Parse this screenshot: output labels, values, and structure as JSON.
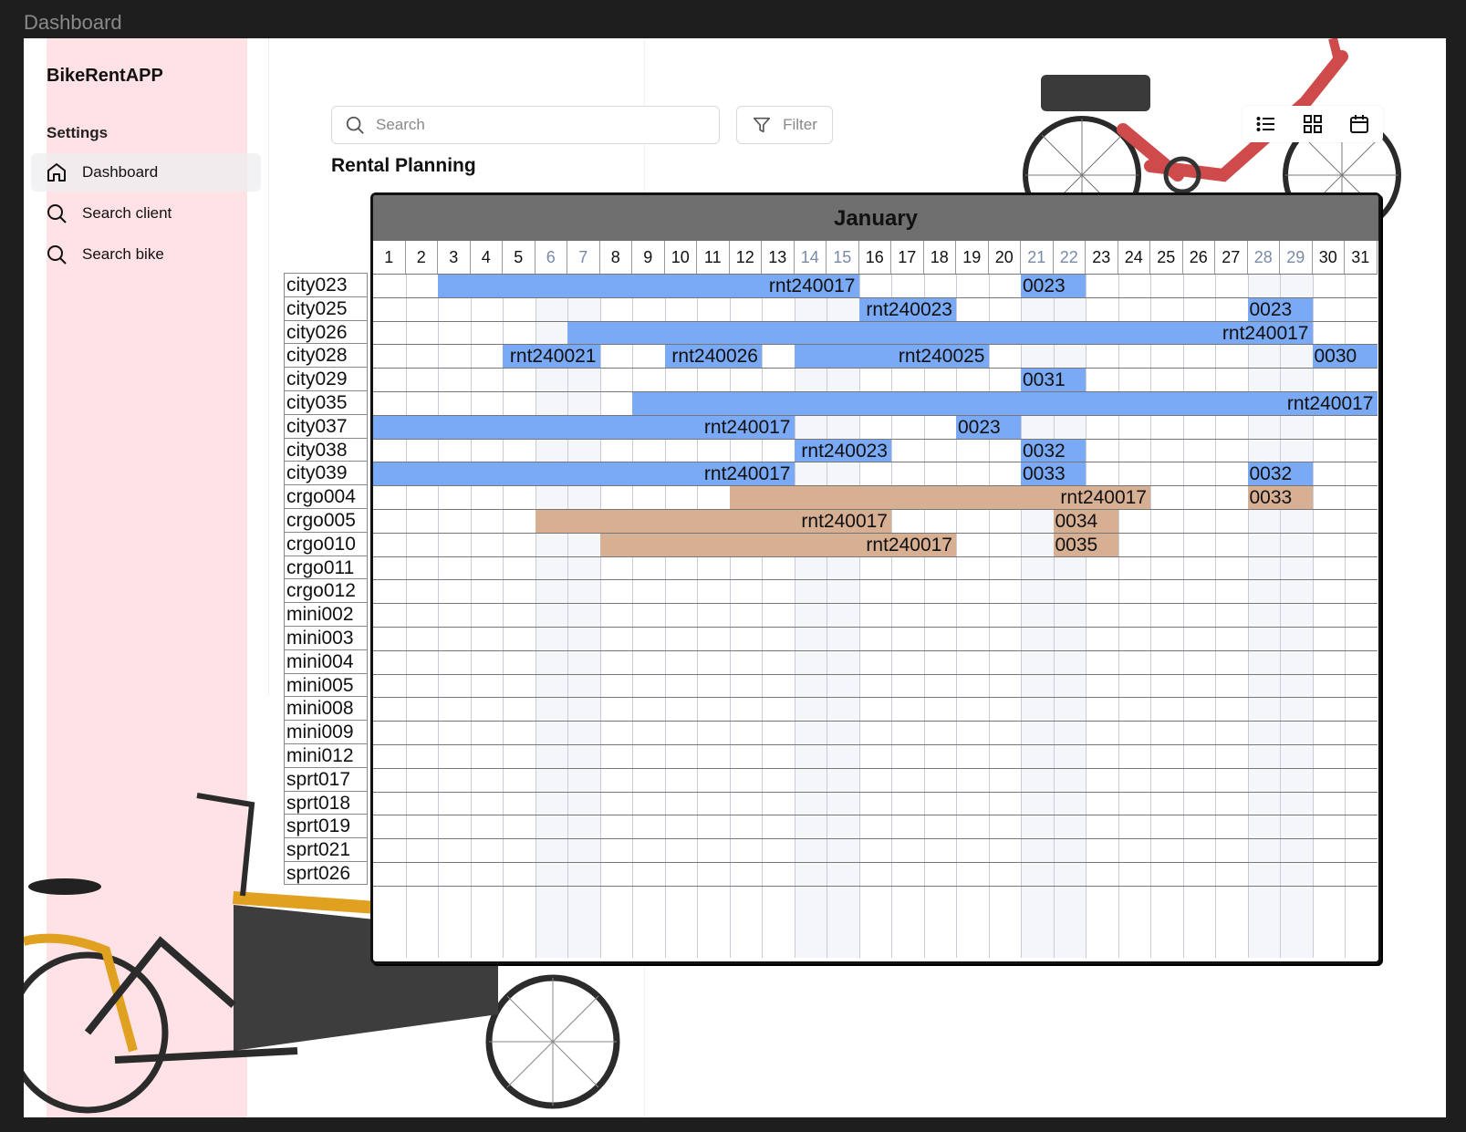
{
  "frame_title": "Dashboard",
  "app": {
    "name": "BikeRentAPP"
  },
  "sidebar": {
    "section_label": "Settings",
    "items": [
      {
        "label": "Dashboard",
        "icon": "home-icon",
        "active": true
      },
      {
        "label": "Search client",
        "icon": "search-icon",
        "active": false
      },
      {
        "label": "Search bike",
        "icon": "search-icon",
        "active": false
      }
    ]
  },
  "toolbar": {
    "search_placeholder": "Search",
    "filter_label": "Filter",
    "views": [
      "list-view-icon",
      "grid-view-icon",
      "calendar-view-icon"
    ]
  },
  "page_title": "Rental Planning",
  "calendar": {
    "month": "January",
    "days": [
      1,
      2,
      3,
      4,
      5,
      6,
      7,
      8,
      9,
      10,
      11,
      12,
      13,
      14,
      15,
      16,
      17,
      18,
      19,
      20,
      21,
      22,
      23,
      24,
      25,
      26,
      27,
      28,
      29,
      30,
      31
    ],
    "weekend_days": [
      6,
      7,
      14,
      15,
      21,
      22,
      28,
      29
    ],
    "bikes": [
      "city023",
      "city025",
      "city026",
      "city028",
      "city029",
      "city035",
      "city037",
      "city038",
      "city039",
      "crgo004",
      "crgo005",
      "crgo010",
      "crgo011",
      "crgo012",
      "mini002",
      "mini003",
      "mini004",
      "mini005",
      "mini008",
      "mini009",
      "mini012",
      "sprt017",
      "sprt018",
      "sprt019",
      "sprt021",
      "sprt026"
    ],
    "bookings": [
      {
        "bike": "city023",
        "start": 3,
        "end": 15,
        "label": "rnt240017",
        "type": "city"
      },
      {
        "bike": "city023",
        "start": 21,
        "end": 22,
        "label": "0023",
        "type": "city"
      },
      {
        "bike": "city025",
        "start": 16,
        "end": 18,
        "label": "rnt240023",
        "type": "city"
      },
      {
        "bike": "city025",
        "start": 28,
        "end": 29,
        "label": "0023",
        "type": "city"
      },
      {
        "bike": "city026",
        "start": 7,
        "end": 29,
        "label": "rnt240017",
        "type": "city"
      },
      {
        "bike": "city028",
        "start": 5,
        "end": 7,
        "label": "rnt240021",
        "type": "city"
      },
      {
        "bike": "city028",
        "start": 10,
        "end": 12,
        "label": "rnt240026",
        "type": "city"
      },
      {
        "bike": "city028",
        "start": 14,
        "end": 19,
        "label": "rnt240025",
        "type": "city"
      },
      {
        "bike": "city028",
        "start": 30,
        "end": 31,
        "label": "0030",
        "type": "city"
      },
      {
        "bike": "city029",
        "start": 21,
        "end": 22,
        "label": "0031",
        "type": "city"
      },
      {
        "bike": "city035",
        "start": 9,
        "end": 31,
        "label": "rnt240017",
        "type": "city"
      },
      {
        "bike": "city037",
        "start": 1,
        "end": 13,
        "label": "rnt240017",
        "type": "city"
      },
      {
        "bike": "city037",
        "start": 19,
        "end": 20,
        "label": "0023",
        "type": "city"
      },
      {
        "bike": "city038",
        "start": 14,
        "end": 16,
        "label": "rnt240023",
        "type": "city"
      },
      {
        "bike": "city038",
        "start": 21,
        "end": 22,
        "label": "0032",
        "type": "city"
      },
      {
        "bike": "city039",
        "start": 1,
        "end": 13,
        "label": "rnt240017",
        "type": "city"
      },
      {
        "bike": "city039",
        "start": 21,
        "end": 22,
        "label": "0033",
        "type": "city"
      },
      {
        "bike": "city039",
        "start": 28,
        "end": 29,
        "label": "0032",
        "type": "city"
      },
      {
        "bike": "crgo004",
        "start": 12,
        "end": 24,
        "label": "rnt240017",
        "type": "cargo"
      },
      {
        "bike": "crgo004",
        "start": 28,
        "end": 29,
        "label": "0033",
        "type": "cargo"
      },
      {
        "bike": "crgo005",
        "start": 6,
        "end": 16,
        "label": "rnt240017",
        "type": "cargo"
      },
      {
        "bike": "crgo005",
        "start": 22,
        "end": 23,
        "label": "0034",
        "type": "cargo"
      },
      {
        "bike": "crgo010",
        "start": 8,
        "end": 18,
        "label": "rnt240017",
        "type": "cargo"
      },
      {
        "bike": "crgo010",
        "start": 22,
        "end": 23,
        "label": "0035",
        "type": "cargo"
      }
    ]
  },
  "colors": {
    "city_booking": "#7aa9f5",
    "cargo_booking": "#d7af93",
    "sidebar_band": "#ffe2e6",
    "month_header": "#6f6f6f"
  }
}
